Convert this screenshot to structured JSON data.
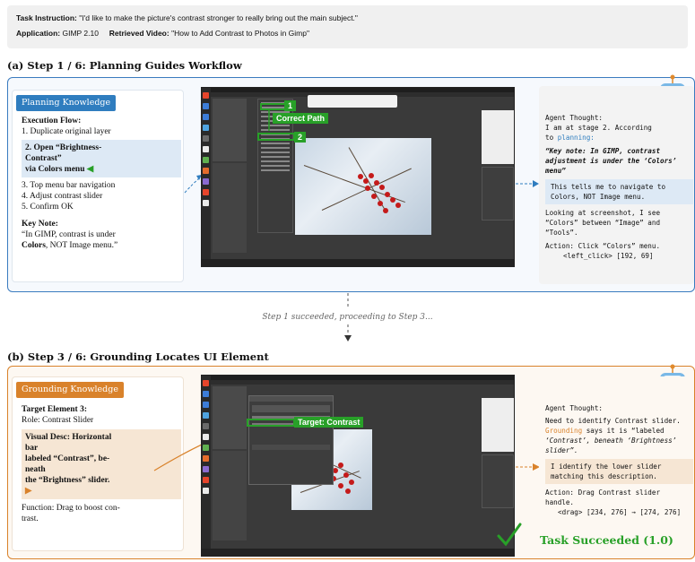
{
  "header": {
    "task_label": "Task Instruction:",
    "task_text": "\"I'd like to make the picture's contrast stronger to really bring out the main subject.\"",
    "app_label": "Application:",
    "app_value": "GIMP 2.10",
    "video_label": "Retrieved Video:",
    "video_value": "\"How to Add Contrast to Photos in Gimp\""
  },
  "section_a": {
    "title": "(a) Step 1 / 6: Planning Guides Workflow",
    "knowledge_badge": "Planning Knowledge",
    "flow_heading": "Execution Flow:",
    "flow_1": "1. Duplicate original layer",
    "flow_2a": "2. Open “Brightness-",
    "flow_2b": "Contrast”",
    "flow_2c": "via Colors menu",
    "flow_3": "3. Top menu bar navigation",
    "flow_4": "4. Adjust contrast slider",
    "flow_5": "5. Confirm OK",
    "note_heading": "Key Note:",
    "note_1": "“In GIMP, contrast is under",
    "note_2a": "Colors",
    "note_2b": ", NOT Image menu.”",
    "tag_correct": "Correct Path",
    "tag_1": "1",
    "tag_2": "2",
    "thought_title": "Agent Thought:",
    "thought_1": "I am at stage 2. According",
    "thought_2": "to",
    "thought_2b": "planning:",
    "thought_q1": "“Key note: In GIMP, contrast",
    "thought_q2": "adjustment is under the ‘Colors’",
    "thought_q3": "menu”",
    "thought_hl1": "This tells me to navigate to",
    "thought_hl2": "Colors, NOT Image menu.",
    "thought_3": "Looking at screenshot, I see",
    "thought_4": "“Colors” between “Image” and",
    "thought_5": "“Tools”.",
    "thought_6": "Action: Click “Colors” menu.",
    "thought_7": "<left_click> [192, 69]"
  },
  "status_text": "Step 1 succeeded, proceeding to Step 3...",
  "section_b": {
    "title": "(b) Step 3 / 6: Grounding Locates UI Element",
    "knowledge_badge": "Grounding Knowledge",
    "target_heading": "Target Element 3:",
    "target_role": "Role: Contrast Slider",
    "desc_1": "Visual Desc: Horizontal",
    "desc_2": "bar",
    "desc_3": "labeled “Contrast”, be-",
    "desc_4": "neath",
    "desc_5": "the “Brightness” slider.",
    "func_1": "Function: Drag to boost con-",
    "func_2": "trast.",
    "tag_target": "Target: Contrast",
    "thought_title": "Agent Thought:",
    "thought_1": "Need to identify Contrast slider.",
    "thought_2a": "Grounding",
    "thought_2b": " says it is “labeled",
    "thought_3": "‘Contrast’, beneath ‘Brightness’",
    "thought_4": "slider”.",
    "thought_hl1": "I identify the lower slider",
    "thought_hl2": "matching this description.",
    "thought_5": "Action: Drag Contrast slider",
    "thought_6": "handle.",
    "thought_7": "<drag> [234, 276] → [274, 276]",
    "success": "Task Succeeded (1.0)"
  },
  "colors": {
    "blue": "#2f7dbf",
    "orange": "#d9822b",
    "green": "#28a028"
  }
}
